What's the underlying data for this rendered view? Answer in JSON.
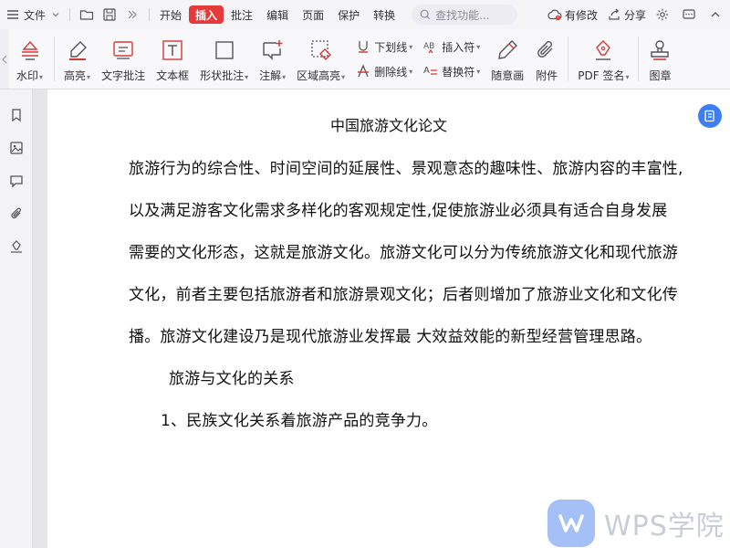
{
  "menubar": {
    "file_label": "文件",
    "tabs": [
      {
        "label": "开始",
        "active": false
      },
      {
        "label": "插入",
        "active": true
      },
      {
        "label": "批注",
        "active": false
      },
      {
        "label": "编辑",
        "active": false
      },
      {
        "label": "页面",
        "active": false
      },
      {
        "label": "保护",
        "active": false
      },
      {
        "label": "转换",
        "active": false
      }
    ],
    "search_placeholder": "查找功能...",
    "modified_label": "有修改",
    "share_label": "分享",
    "accent_color": "#e53a3a"
  },
  "ribbon": {
    "watermark_label": "水印",
    "highlight_label": "高亮",
    "text_comment_label": "文字批注",
    "textbox_label": "文本框",
    "shape_comment_label": "形状批注",
    "annotation_label": "注解",
    "area_highlight_label": "区域高亮",
    "underline_label": "下划线",
    "strikethrough_label": "删除线",
    "insert_char_label": "插入符",
    "replace_char_label": "替换符",
    "freehand_label": "随意画",
    "attachment_label": "附件",
    "pdf_sign_label": "PDF 签名",
    "stamp_label": "图章"
  },
  "document": {
    "title": "中国旅游文化论文",
    "lines": [
      "旅游行为的综合性、时间空间的延展性、景观意态的趣味性、旅游内容的丰富性,",
      "以及满足游客文化需求多样化的客观规定性,促使旅游业必须具有适合自身发展",
      "需要的文化形态，这就是旅游文化。旅游文化可以分为传统旅游文化和现代旅游",
      "文化，前者主要包括旅游者和旅游景观文化；后者则增加了旅游业文化和文化传",
      "播。旅游文化建设乃是现代旅游业发挥最  大效益效能的新型经营管理思路。"
    ],
    "section_heading": "旅游与文化的关系",
    "list_item": "1、民族文化关系着旅游产品的竞争力。"
  },
  "watermark": {
    "text": "WPS学院"
  }
}
